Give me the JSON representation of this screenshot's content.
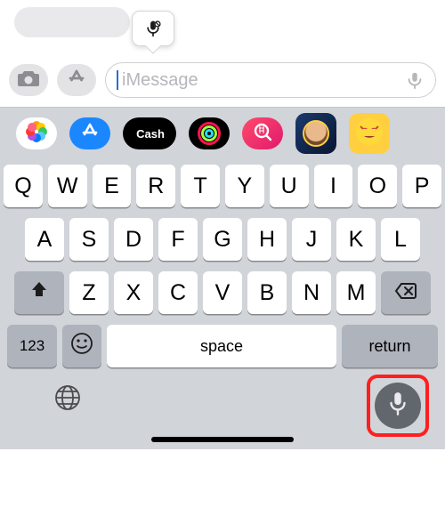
{
  "chat": {
    "input_placeholder": "iMessage",
    "dictation_tip_icon": "mic-off-icon"
  },
  "app_strip": {
    "items": [
      {
        "name": "photos-app-icon"
      },
      {
        "name": "appstore-app-icon"
      },
      {
        "name": "apple-cash-app-icon",
        "label": "Cash"
      },
      {
        "name": "fitness-app-icon"
      },
      {
        "name": "image-search-app-icon"
      },
      {
        "name": "memoji-app-icon"
      },
      {
        "name": "memoji-stickers-app-icon"
      }
    ]
  },
  "keyboard": {
    "row1": [
      "Q",
      "W",
      "E",
      "R",
      "T",
      "Y",
      "U",
      "I",
      "O",
      "P"
    ],
    "row2": [
      "A",
      "S",
      "D",
      "F",
      "G",
      "H",
      "J",
      "K",
      "L"
    ],
    "row3": [
      "Z",
      "X",
      "C",
      "V",
      "B",
      "N",
      "M"
    ],
    "shift_icon": "shift-icon",
    "backspace_icon": "backspace-icon",
    "numbers_label": "123",
    "emoji_icon": "emoji-icon",
    "space_label": "space",
    "return_label": "return"
  },
  "bottom": {
    "globe_icon": "globe-icon",
    "dictation_icon": "microphone-icon"
  }
}
